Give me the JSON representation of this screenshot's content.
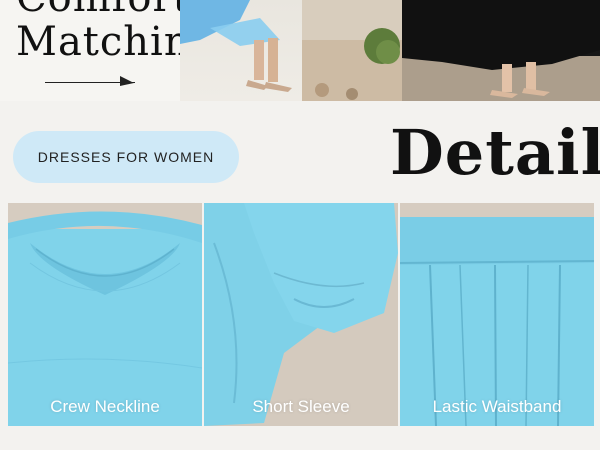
{
  "banner": {
    "headline_line1": "Comfort",
    "headline_line2": "Matching"
  },
  "category_button": {
    "label": "DRESSES FOR WOMEN"
  },
  "section_title": "Detail",
  "details": [
    {
      "label": "Crew Neckline"
    },
    {
      "label": "Short Sleeve"
    },
    {
      "label": "Lastic Waistband"
    }
  ],
  "colors": {
    "background": "#f3f2ef",
    "button_bg": "#cfe9f7",
    "fabric_blue": "#80d3ea",
    "text_dark": "#111111",
    "label_text": "#ffffff"
  },
  "icons": {
    "arrow": "right-arrow-icon"
  }
}
